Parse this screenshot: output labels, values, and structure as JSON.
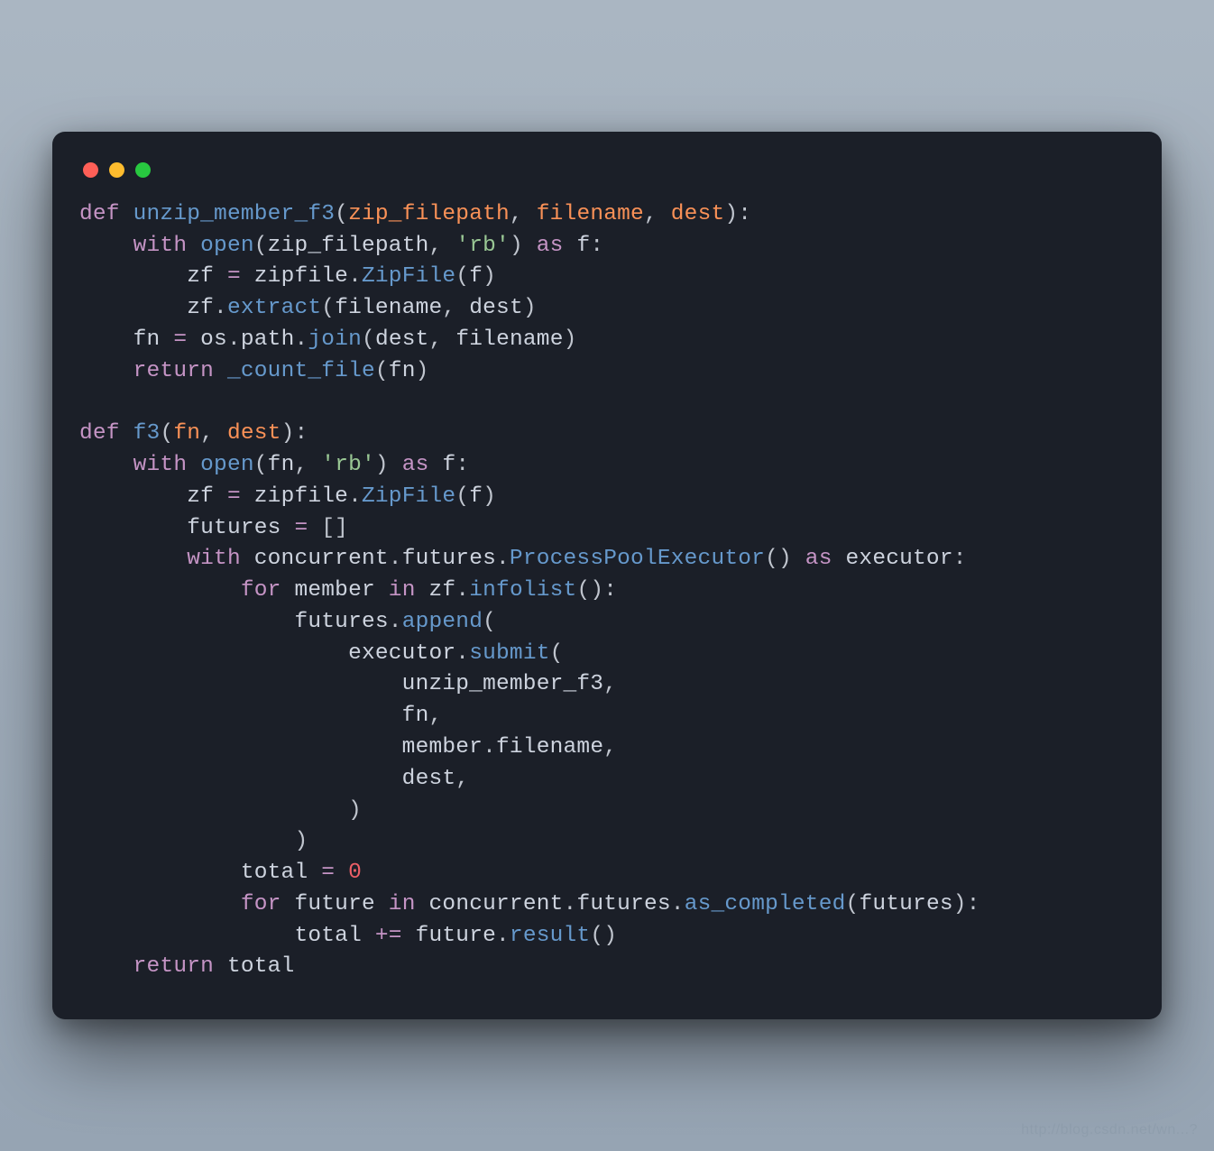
{
  "window": {
    "traffic_lights": [
      "red",
      "yellow",
      "green"
    ]
  },
  "code": {
    "lines": [
      [
        {
          "t": "def ",
          "c": "kw"
        },
        {
          "t": "unzip_member_f3",
          "c": "fn"
        },
        {
          "t": "(",
          "c": "pun"
        },
        {
          "t": "zip_filepath",
          "c": "arg"
        },
        {
          "t": ", ",
          "c": "pun"
        },
        {
          "t": "filename",
          "c": "arg"
        },
        {
          "t": ", ",
          "c": "pun"
        },
        {
          "t": "dest",
          "c": "arg"
        },
        {
          "t": "):",
          "c": "pun"
        }
      ],
      [
        {
          "t": "    ",
          "c": "pun"
        },
        {
          "t": "with ",
          "c": "kw"
        },
        {
          "t": "open",
          "c": "fn"
        },
        {
          "t": "(",
          "c": "pun"
        },
        {
          "t": "zip_filepath",
          "c": "var"
        },
        {
          "t": ", ",
          "c": "pun"
        },
        {
          "t": "'rb'",
          "c": "str"
        },
        {
          "t": ") ",
          "c": "pun"
        },
        {
          "t": "as ",
          "c": "kw"
        },
        {
          "t": "f",
          "c": "var"
        },
        {
          "t": ":",
          "c": "pun"
        }
      ],
      [
        {
          "t": "        ",
          "c": "pun"
        },
        {
          "t": "zf ",
          "c": "var"
        },
        {
          "t": "= ",
          "c": "eq"
        },
        {
          "t": "zipfile",
          "c": "var"
        },
        {
          "t": ".",
          "c": "pun"
        },
        {
          "t": "ZipFile",
          "c": "fn"
        },
        {
          "t": "(",
          "c": "pun"
        },
        {
          "t": "f",
          "c": "var"
        },
        {
          "t": ")",
          "c": "pun"
        }
      ],
      [
        {
          "t": "        ",
          "c": "pun"
        },
        {
          "t": "zf",
          "c": "var"
        },
        {
          "t": ".",
          "c": "pun"
        },
        {
          "t": "extract",
          "c": "fn"
        },
        {
          "t": "(",
          "c": "pun"
        },
        {
          "t": "filename",
          "c": "var"
        },
        {
          "t": ", ",
          "c": "pun"
        },
        {
          "t": "dest",
          "c": "var"
        },
        {
          "t": ")",
          "c": "pun"
        }
      ],
      [
        {
          "t": "    ",
          "c": "pun"
        },
        {
          "t": "fn ",
          "c": "var"
        },
        {
          "t": "= ",
          "c": "eq"
        },
        {
          "t": "os",
          "c": "var"
        },
        {
          "t": ".",
          "c": "pun"
        },
        {
          "t": "path",
          "c": "var"
        },
        {
          "t": ".",
          "c": "pun"
        },
        {
          "t": "join",
          "c": "fn"
        },
        {
          "t": "(",
          "c": "pun"
        },
        {
          "t": "dest",
          "c": "var"
        },
        {
          "t": ", ",
          "c": "pun"
        },
        {
          "t": "filename",
          "c": "var"
        },
        {
          "t": ")",
          "c": "pun"
        }
      ],
      [
        {
          "t": "    ",
          "c": "pun"
        },
        {
          "t": "return ",
          "c": "kw"
        },
        {
          "t": "_count_file",
          "c": "fn"
        },
        {
          "t": "(",
          "c": "pun"
        },
        {
          "t": "fn",
          "c": "var"
        },
        {
          "t": ")",
          "c": "pun"
        }
      ],
      [
        {
          "t": " ",
          "c": "pun"
        }
      ],
      [
        {
          "t": "def ",
          "c": "kw"
        },
        {
          "t": "f3",
          "c": "fn"
        },
        {
          "t": "(",
          "c": "pun"
        },
        {
          "t": "fn",
          "c": "arg"
        },
        {
          "t": ", ",
          "c": "pun"
        },
        {
          "t": "dest",
          "c": "arg"
        },
        {
          "t": "):",
          "c": "pun"
        }
      ],
      [
        {
          "t": "    ",
          "c": "pun"
        },
        {
          "t": "with ",
          "c": "kw"
        },
        {
          "t": "open",
          "c": "fn"
        },
        {
          "t": "(",
          "c": "pun"
        },
        {
          "t": "fn",
          "c": "var"
        },
        {
          "t": ", ",
          "c": "pun"
        },
        {
          "t": "'rb'",
          "c": "str"
        },
        {
          "t": ") ",
          "c": "pun"
        },
        {
          "t": "as ",
          "c": "kw"
        },
        {
          "t": "f",
          "c": "var"
        },
        {
          "t": ":",
          "c": "pun"
        }
      ],
      [
        {
          "t": "        ",
          "c": "pun"
        },
        {
          "t": "zf ",
          "c": "var"
        },
        {
          "t": "= ",
          "c": "eq"
        },
        {
          "t": "zipfile",
          "c": "var"
        },
        {
          "t": ".",
          "c": "pun"
        },
        {
          "t": "ZipFile",
          "c": "fn"
        },
        {
          "t": "(",
          "c": "pun"
        },
        {
          "t": "f",
          "c": "var"
        },
        {
          "t": ")",
          "c": "pun"
        }
      ],
      [
        {
          "t": "        ",
          "c": "pun"
        },
        {
          "t": "futures ",
          "c": "var"
        },
        {
          "t": "= ",
          "c": "eq"
        },
        {
          "t": "[]",
          "c": "pun"
        }
      ],
      [
        {
          "t": "        ",
          "c": "pun"
        },
        {
          "t": "with ",
          "c": "kw"
        },
        {
          "t": "concurrent",
          "c": "var"
        },
        {
          "t": ".",
          "c": "pun"
        },
        {
          "t": "futures",
          "c": "var"
        },
        {
          "t": ".",
          "c": "pun"
        },
        {
          "t": "ProcessPoolExecutor",
          "c": "fn"
        },
        {
          "t": "() ",
          "c": "pun"
        },
        {
          "t": "as ",
          "c": "kw"
        },
        {
          "t": "executor",
          "c": "var"
        },
        {
          "t": ":",
          "c": "pun"
        }
      ],
      [
        {
          "t": "            ",
          "c": "pun"
        },
        {
          "t": "for ",
          "c": "kw"
        },
        {
          "t": "member ",
          "c": "var"
        },
        {
          "t": "in ",
          "c": "kw"
        },
        {
          "t": "zf",
          "c": "var"
        },
        {
          "t": ".",
          "c": "pun"
        },
        {
          "t": "infolist",
          "c": "fn"
        },
        {
          "t": "():",
          "c": "pun"
        }
      ],
      [
        {
          "t": "                ",
          "c": "pun"
        },
        {
          "t": "futures",
          "c": "var"
        },
        {
          "t": ".",
          "c": "pun"
        },
        {
          "t": "append",
          "c": "fn"
        },
        {
          "t": "(",
          "c": "pun"
        }
      ],
      [
        {
          "t": "                    ",
          "c": "pun"
        },
        {
          "t": "executor",
          "c": "var"
        },
        {
          "t": ".",
          "c": "pun"
        },
        {
          "t": "submit",
          "c": "fn"
        },
        {
          "t": "(",
          "c": "pun"
        }
      ],
      [
        {
          "t": "                        ",
          "c": "pun"
        },
        {
          "t": "unzip_member_f3",
          "c": "var"
        },
        {
          "t": ",",
          "c": "pun"
        }
      ],
      [
        {
          "t": "                        ",
          "c": "pun"
        },
        {
          "t": "fn",
          "c": "var"
        },
        {
          "t": ",",
          "c": "pun"
        }
      ],
      [
        {
          "t": "                        ",
          "c": "pun"
        },
        {
          "t": "member",
          "c": "var"
        },
        {
          "t": ".",
          "c": "pun"
        },
        {
          "t": "filename",
          "c": "var"
        },
        {
          "t": ",",
          "c": "pun"
        }
      ],
      [
        {
          "t": "                        ",
          "c": "pun"
        },
        {
          "t": "dest",
          "c": "var"
        },
        {
          "t": ",",
          "c": "pun"
        }
      ],
      [
        {
          "t": "                    )",
          "c": "pun"
        }
      ],
      [
        {
          "t": "                )",
          "c": "pun"
        }
      ],
      [
        {
          "t": "            ",
          "c": "pun"
        },
        {
          "t": "total ",
          "c": "var"
        },
        {
          "t": "= ",
          "c": "eq"
        },
        {
          "t": "0",
          "c": "num"
        }
      ],
      [
        {
          "t": "            ",
          "c": "pun"
        },
        {
          "t": "for ",
          "c": "kw"
        },
        {
          "t": "future ",
          "c": "var"
        },
        {
          "t": "in ",
          "c": "kw"
        },
        {
          "t": "concurrent",
          "c": "var"
        },
        {
          "t": ".",
          "c": "pun"
        },
        {
          "t": "futures",
          "c": "var"
        },
        {
          "t": ".",
          "c": "pun"
        },
        {
          "t": "as_completed",
          "c": "fn"
        },
        {
          "t": "(",
          "c": "pun"
        },
        {
          "t": "futures",
          "c": "var"
        },
        {
          "t": "):",
          "c": "pun"
        }
      ],
      [
        {
          "t": "                ",
          "c": "pun"
        },
        {
          "t": "total ",
          "c": "var"
        },
        {
          "t": "+= ",
          "c": "eq"
        },
        {
          "t": "future",
          "c": "var"
        },
        {
          "t": ".",
          "c": "pun"
        },
        {
          "t": "result",
          "c": "fn"
        },
        {
          "t": "()",
          "c": "pun"
        }
      ],
      [
        {
          "t": "    ",
          "c": "pun"
        },
        {
          "t": "return ",
          "c": "kw"
        },
        {
          "t": "total",
          "c": "var"
        }
      ]
    ]
  },
  "watermark": "http://blog.csdn.net/wn...?"
}
